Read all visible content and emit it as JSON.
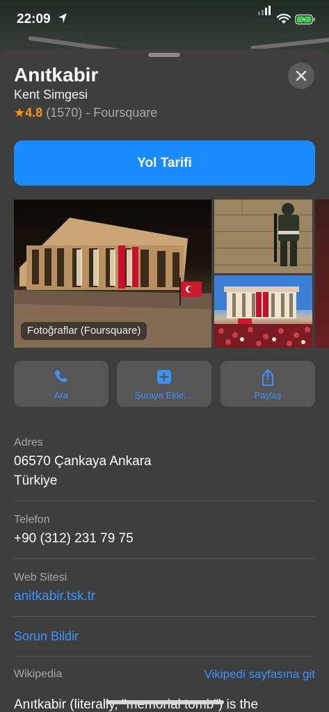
{
  "status_bar": {
    "time": "22:09"
  },
  "place": {
    "title": "Anıtkabir",
    "category": "Kent Simgesi",
    "rating_star": "★",
    "rating_score": "4.8",
    "rating_count": "(1570)",
    "rating_source": "- Foursquare"
  },
  "directions_label": "Yol Tarifi",
  "photos_label": "Fotoğraflar (Foursquare)",
  "actions": [
    {
      "label": "Ara",
      "icon": "phone-icon"
    },
    {
      "label": "Şuraya Ekle:...",
      "icon": "plus-square-icon"
    },
    {
      "label": "Paylaş",
      "icon": "share-icon"
    }
  ],
  "address": {
    "label": "Adres",
    "line1": "06570 Çankaya Ankara",
    "line2": "Türkiye"
  },
  "phone": {
    "label": "Telefon",
    "value": "+90 (312) 231 79 75"
  },
  "website": {
    "label": "Web Sitesi",
    "value": "anitkabir.tsk.tr"
  },
  "report_issue": "Sorun Bildir",
  "wikipedia": {
    "label": "Wikipedia",
    "link": "Vikipedi sayfasına git",
    "snippet": "Anıtkabir (literally, \"memorial tomb\") is the"
  },
  "colors": {
    "accent": "#1a8cff",
    "link": "#3b93ff",
    "rating": "#ff9500",
    "sheet_bg": "#3d3e3d"
  }
}
